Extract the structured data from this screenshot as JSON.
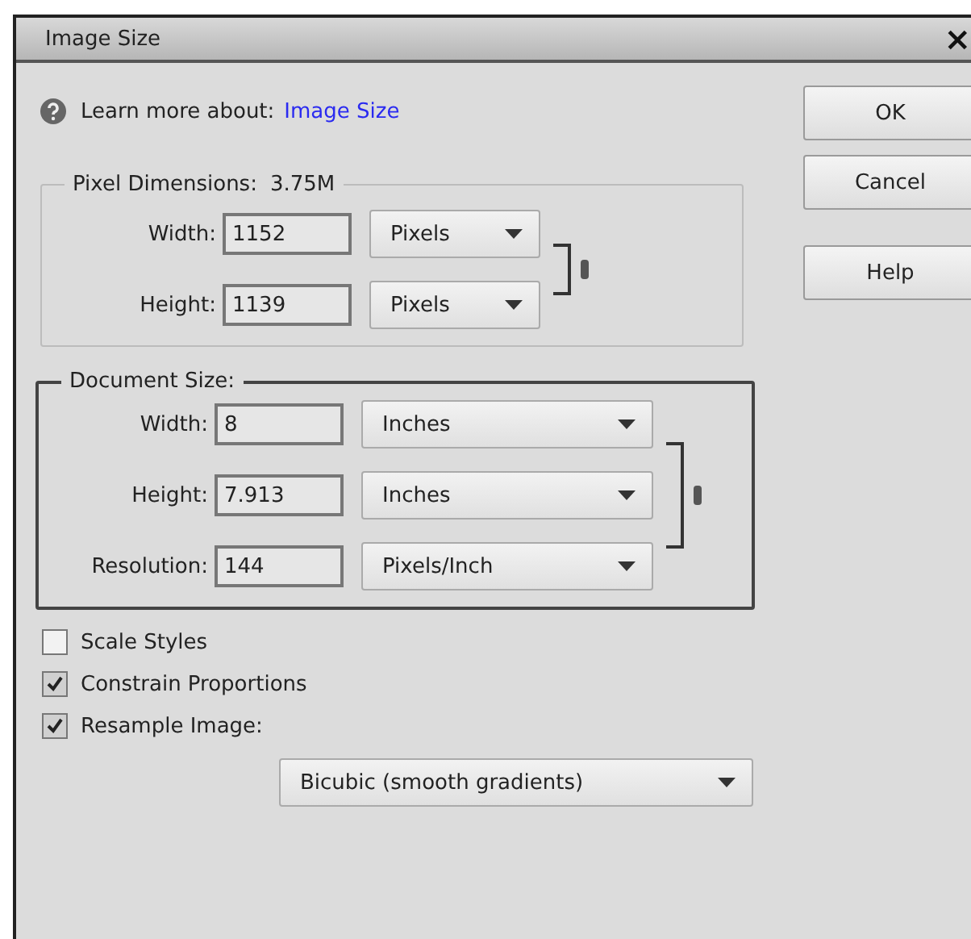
{
  "window": {
    "title": "Image Size",
    "close": "×"
  },
  "help": {
    "label": "Learn more about:",
    "link": "Image Size"
  },
  "buttons": [
    {
      "label": "OK"
    },
    {
      "label": "Cancel"
    },
    {
      "label": "Help"
    }
  ],
  "pixel_dimensions": {
    "title": "Pixel Dimensions:",
    "size": "3.75M",
    "linked": true,
    "fields": [
      {
        "label": "Width:",
        "value": "1152",
        "unit": "Pixels"
      },
      {
        "label": "Height:",
        "value": "1139",
        "unit": "Pixels"
      }
    ]
  },
  "document_size": {
    "title": "Document Size:",
    "linked": true,
    "fields": [
      {
        "label": "Width:",
        "value": "8",
        "unit": "Inches"
      },
      {
        "label": "Height:",
        "value": "7.913",
        "unit": "Inches"
      },
      {
        "label": "Resolution:",
        "value": "144",
        "unit": "Pixels/Inch"
      }
    ]
  },
  "options": [
    {
      "label": "Scale Styles",
      "checked": false
    },
    {
      "label": "Constrain Proportions",
      "checked": true
    },
    {
      "label": "Resample Image:",
      "checked": true
    }
  ],
  "resample_method": "Bicubic (smooth gradients)"
}
